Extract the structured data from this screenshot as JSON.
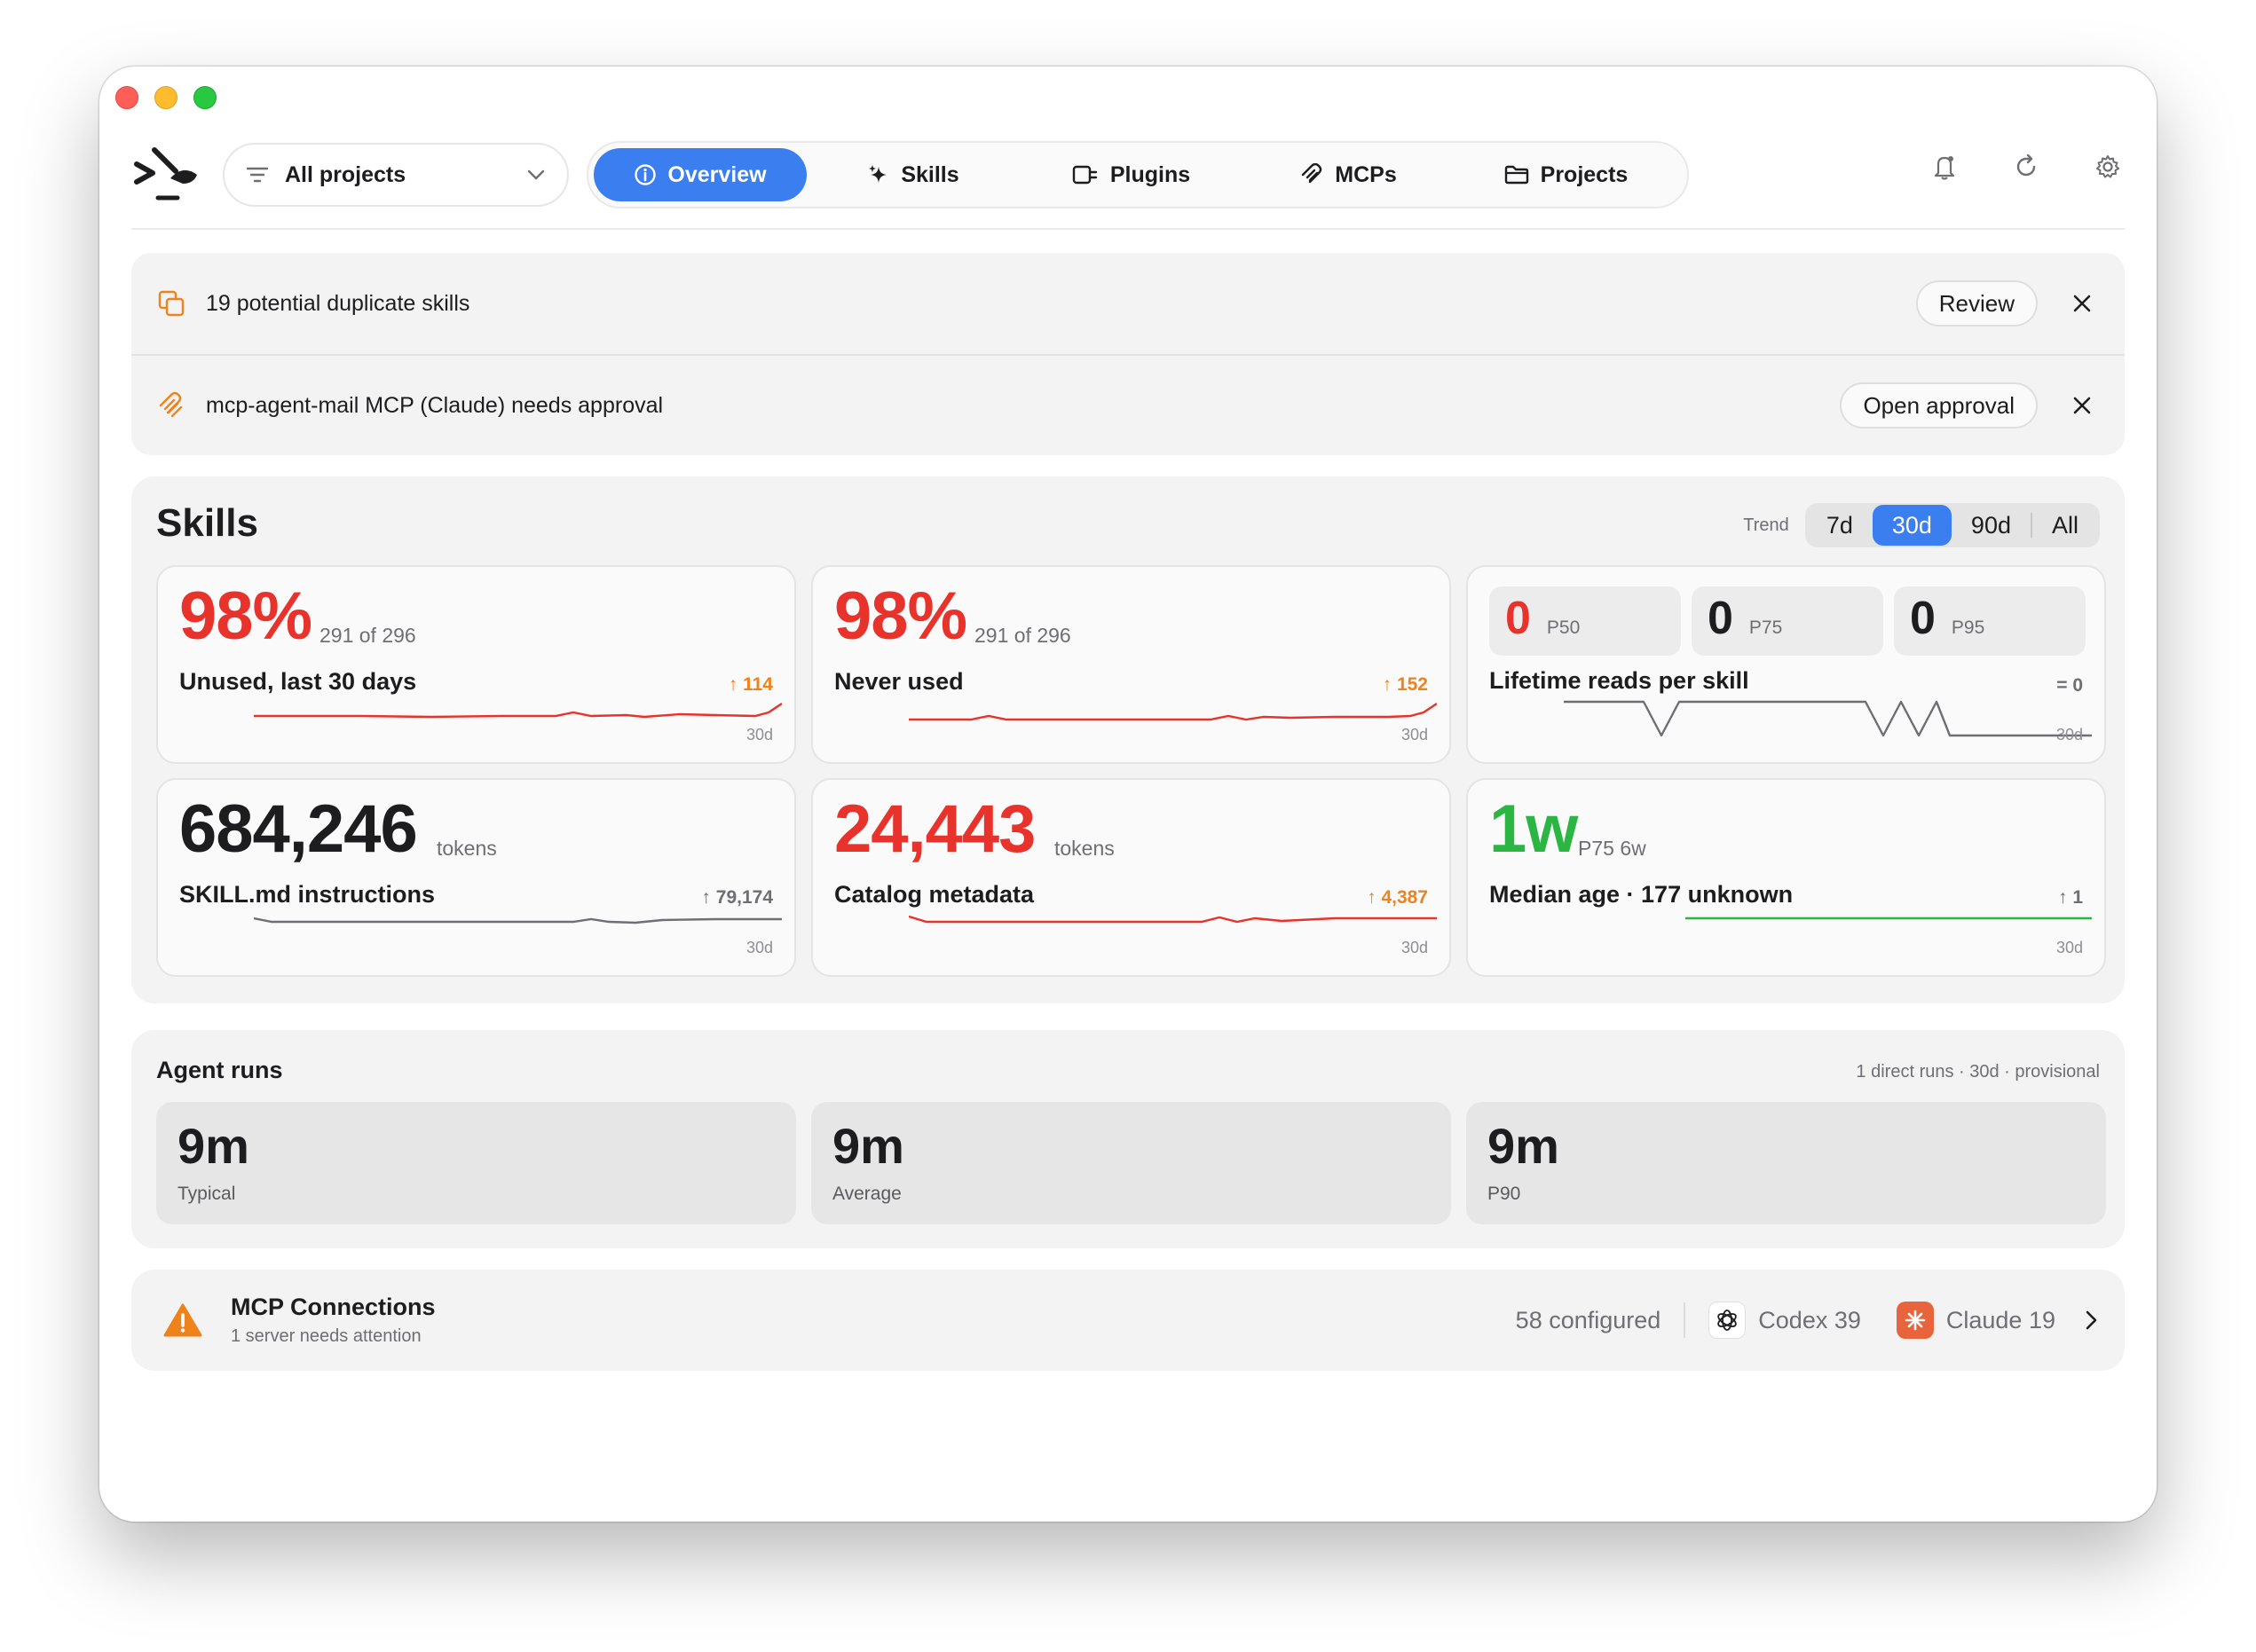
{
  "toolbar": {
    "project_select": "All projects",
    "tabs": [
      {
        "label": "Overview",
        "icon": "info-circle-icon",
        "active": true
      },
      {
        "label": "Skills",
        "icon": "sparkle-icon",
        "active": false
      },
      {
        "label": "Plugins",
        "icon": "plug-icon",
        "active": false
      },
      {
        "label": "MCPs",
        "icon": "mcp-icon",
        "active": false
      },
      {
        "label": "Projects",
        "icon": "folder-icon",
        "active": false
      }
    ]
  },
  "alerts": [
    {
      "message": "19 potential duplicate skills",
      "action": "Review",
      "icon": "duplicate-icon"
    },
    {
      "message": "mcp-agent-mail MCP (Claude) needs approval",
      "action": "Open approval",
      "icon": "mcp-icon"
    }
  ],
  "skills": {
    "title": "Skills",
    "trend_label": "Trend",
    "trend_options": [
      "7d",
      "30d",
      "90d",
      "All"
    ],
    "trend_selected": "30d",
    "cards": {
      "unused": {
        "value": "98%",
        "sub": "291 of 296",
        "label": "Unused, last 30 days",
        "delta": "114",
        "period": "30d",
        "color": "#e8332c"
      },
      "never_used": {
        "value": "98%",
        "sub": "291 of 296",
        "label": "Never used",
        "delta": "152",
        "period": "30d",
        "color": "#e8332c"
      },
      "lifetime_reads": {
        "percentiles": [
          {
            "value": "0",
            "key": "P50",
            "color": "#e8332c"
          },
          {
            "value": "0",
            "key": "P75",
            "color": "#1d1d1f"
          },
          {
            "value": "0",
            "key": "P95",
            "color": "#1d1d1f"
          }
        ],
        "label": "Lifetime reads per skill",
        "delta": "= 0",
        "period": "30d"
      },
      "instructions": {
        "value": "684,246",
        "sub": "tokens",
        "label": "SKILL.md instructions",
        "delta": "79,174",
        "period": "30d",
        "color": "#1d1d1f"
      },
      "catalog": {
        "value": "24,443",
        "sub": "tokens",
        "label": "Catalog metadata",
        "delta": "4,387",
        "period": "30d",
        "color": "#e8332c"
      },
      "median_age": {
        "value": "1w",
        "sub": "P75 6w",
        "label": "Median age · 177 unknown",
        "delta": "1",
        "period": "30d",
        "color": "#2bb543"
      }
    }
  },
  "agent_runs": {
    "title": "Agent runs",
    "meta": "1 direct runs · 30d · provisional",
    "stats": [
      {
        "value": "9m",
        "label": "Typical"
      },
      {
        "value": "9m",
        "label": "Average"
      },
      {
        "value": "9m",
        "label": "P90"
      }
    ]
  },
  "mcp_connections": {
    "title": "MCP Connections",
    "subtitle": "1 server needs attention",
    "configured": "58 configured",
    "codex": "Codex 39",
    "claude": "Claude 19"
  }
}
